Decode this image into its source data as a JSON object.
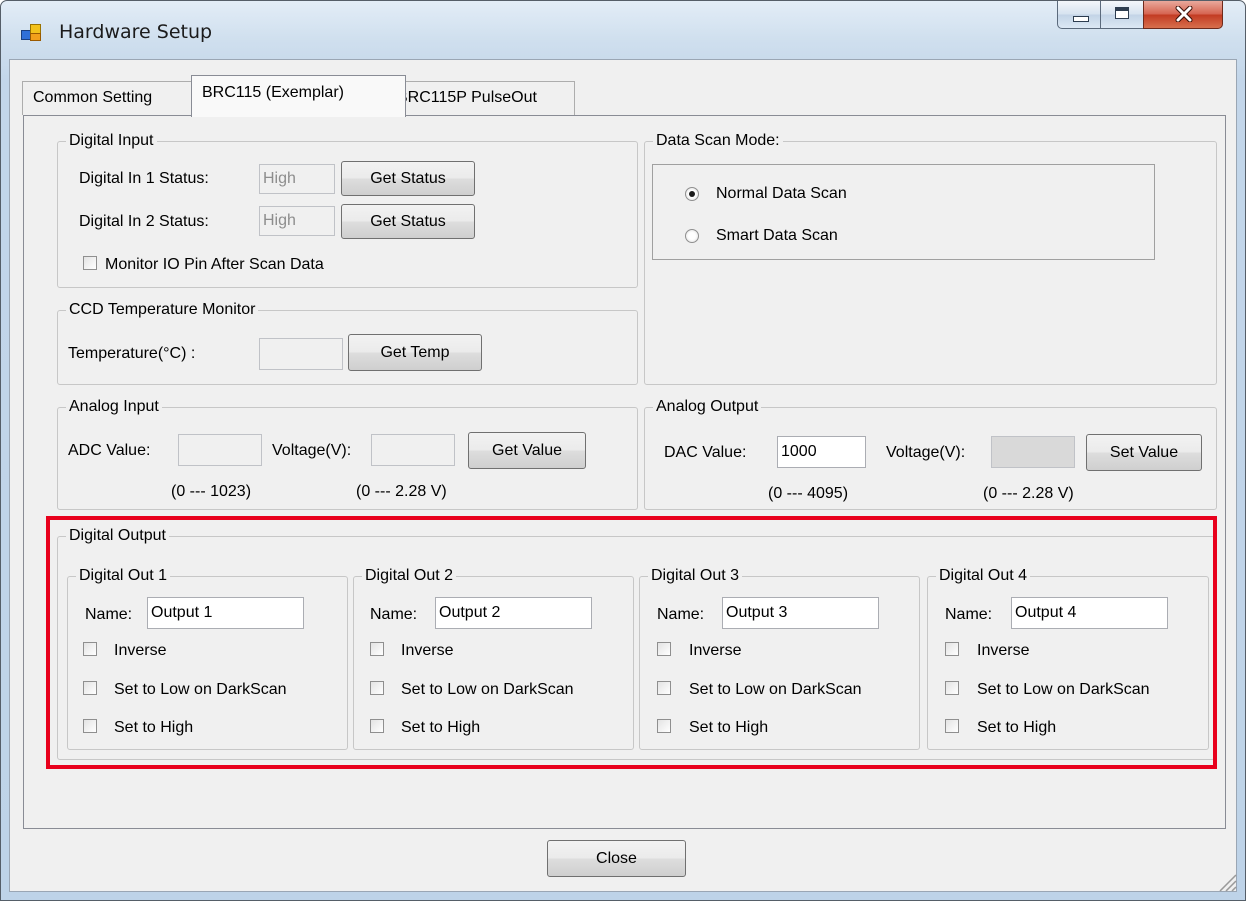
{
  "window": {
    "title": "Hardware Setup",
    "icons": {
      "app": "app-window-icon",
      "min": "minimize-icon",
      "max": "maximize-icon",
      "close": "close-icon"
    }
  },
  "tabs": [
    {
      "label": "Common Setting",
      "selected": false
    },
    {
      "label": "BRC115 (Exemplar)",
      "selected": true
    },
    {
      "label": "BRC115P PulseOut",
      "selected": false
    }
  ],
  "digital_input": {
    "title": "Digital Input",
    "in1_label": "Digital In 1 Status:",
    "in1_value": "High",
    "in2_label": "Digital In 2 Status:",
    "in2_value": "High",
    "get_status_label": "Get Status",
    "monitor_label": "Monitor IO Pin After Scan Data",
    "monitor_checked": false
  },
  "data_scan": {
    "title": "Data Scan Mode:",
    "options": [
      {
        "label": "Normal Data Scan",
        "selected": true
      },
      {
        "label": "Smart Data Scan",
        "selected": false
      }
    ]
  },
  "ccd": {
    "title": "CCD Temperature Monitor",
    "temp_label": "Temperature(°C) :",
    "temp_value": "",
    "button": "Get Temp"
  },
  "analog_input": {
    "title": "Analog Input",
    "adc_label": "ADC Value:",
    "adc_value": "",
    "voltage_label": "Voltage(V):",
    "voltage_value": "",
    "button": "Get Value",
    "adc_range": "(0 --- 1023)",
    "voltage_range": "(0 --- 2.28 V)"
  },
  "analog_output": {
    "title": "Analog Output",
    "dac_label": "DAC Value:",
    "dac_value": "1000",
    "voltage_label": "Voltage(V):",
    "voltage_value": "",
    "button": "Set Value",
    "dac_range": "(0 --- 4095)",
    "voltage_range": "(0 --- 2.28 V)"
  },
  "digital_output": {
    "title": "Digital Output",
    "name_label": "Name:",
    "inverse_label": "Inverse",
    "low_dark_label": "Set to Low on DarkScan",
    "high_label": "Set to High",
    "outputs": [
      {
        "title": "Digital Out  1",
        "name": "Output 1"
      },
      {
        "title": "Digital Out  2",
        "name": "Output 2"
      },
      {
        "title": "Digital Out  3",
        "name": "Output 3"
      },
      {
        "title": "Digital Out  4",
        "name": "Output 4"
      }
    ]
  },
  "footer": {
    "close_label": "Close"
  },
  "colors": {
    "highlight": "#e8001c"
  }
}
